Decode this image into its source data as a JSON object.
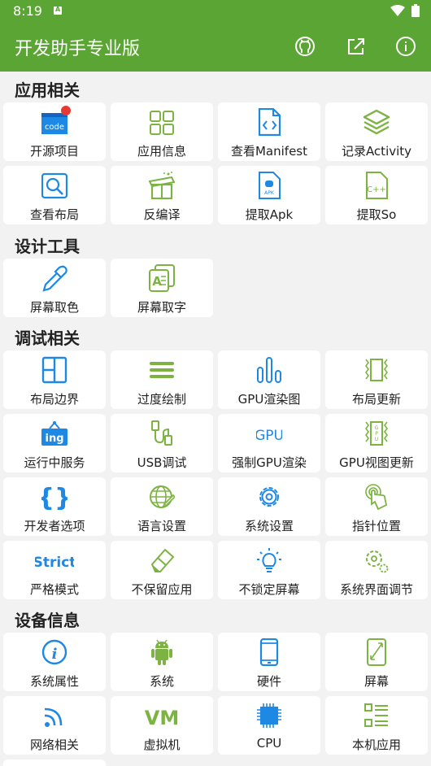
{
  "status_bar": {
    "time": "8:19",
    "notification_badge": "A"
  },
  "app_bar": {
    "title": "开发助手专业版",
    "actions": [
      "github-icon",
      "share-icon",
      "info-icon"
    ]
  },
  "colors": {
    "primary": "#5aa533",
    "icon_blue": "#1e88e5",
    "icon_green": "#7cb342",
    "badge_red": "#e53935"
  },
  "sections": [
    {
      "title": "应用相关",
      "tiles": [
        {
          "label": "开源项目",
          "icon": "code-window-icon",
          "has_badge": true
        },
        {
          "label": "应用信息",
          "icon": "grid-icon"
        },
        {
          "label": "查看Manifest",
          "icon": "code-file-icon"
        },
        {
          "label": "记录Activity",
          "icon": "layers-icon"
        },
        {
          "label": "查看布局",
          "icon": "layout-search-icon"
        },
        {
          "label": "反编译",
          "icon": "gift-box-icon"
        },
        {
          "label": "提取Apk",
          "icon": "apk-file-icon"
        },
        {
          "label": "提取So",
          "icon": "cpp-file-icon"
        }
      ]
    },
    {
      "title": "设计工具",
      "tiles": [
        {
          "label": "屏幕取色",
          "icon": "eyedropper-icon"
        },
        {
          "label": "屏幕取字",
          "icon": "text-capture-icon"
        }
      ]
    },
    {
      "title": "调试相关",
      "tiles": [
        {
          "label": "布局边界",
          "icon": "layout-bounds-icon"
        },
        {
          "label": "过度绘制",
          "icon": "overdraw-icon"
        },
        {
          "label": "GPU渲染图",
          "icon": "bar-chart-icon"
        },
        {
          "label": "布局更新",
          "icon": "layout-update-icon"
        },
        {
          "label": "运行中服务",
          "icon": "ing-sign-icon"
        },
        {
          "label": "USB调试",
          "icon": "usb-cable-icon"
        },
        {
          "label": "强制GPU渲染",
          "icon": "gpu-text-icon"
        },
        {
          "label": "GPU视图更新",
          "icon": "gpu-view-icon"
        },
        {
          "label": "开发者选项",
          "icon": "braces-icon"
        },
        {
          "label": "语言设置",
          "icon": "globe-pen-icon"
        },
        {
          "label": "系统设置",
          "icon": "gear-icon"
        },
        {
          "label": "指针位置",
          "icon": "touch-pointer-icon"
        },
        {
          "label": "严格模式",
          "icon": "strict-text-icon"
        },
        {
          "label": "不保留应用",
          "icon": "eraser-icon"
        },
        {
          "label": "不锁定屏幕",
          "icon": "lightbulb-icon"
        },
        {
          "label": "系统界面调节",
          "icon": "gears-icon"
        }
      ]
    },
    {
      "title": "设备信息",
      "tiles": [
        {
          "label": "系统属性",
          "icon": "info-circle-icon"
        },
        {
          "label": "系统",
          "icon": "android-icon"
        },
        {
          "label": "硬件",
          "icon": "phone-icon"
        },
        {
          "label": "屏幕",
          "icon": "screen-icon"
        },
        {
          "label": "网络相关",
          "icon": "wifi-icon"
        },
        {
          "label": "虚拟机",
          "icon": "vm-text-icon"
        },
        {
          "label": "CPU",
          "icon": "cpu-chip-icon"
        },
        {
          "label": "本机应用",
          "icon": "app-list-icon"
        }
      ]
    }
  ],
  "icon_texts": {
    "code": "code",
    "apk": "APK",
    "cpp": "C++",
    "ing": "ing",
    "gpu": "GPU",
    "gpu_vertical": "GPU",
    "strict": "Strict",
    "vm": "VM"
  }
}
